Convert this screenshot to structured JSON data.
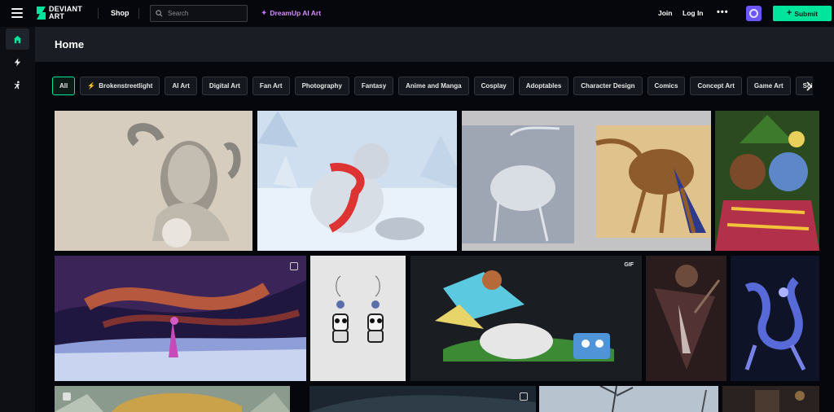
{
  "topbar": {
    "logo_text": "DEVIANT ART",
    "shop_label": "Shop",
    "search_placeholder": "Search",
    "dreamup_label": "DreamUp AI Art",
    "join_label": "Join",
    "login_label": "Log In",
    "more_label": "•••",
    "submit_label": "Submit"
  },
  "sidebar": {
    "items": [
      {
        "name": "home",
        "icon": "home-icon",
        "active": true
      },
      {
        "name": "activity",
        "icon": "lightning-icon",
        "active": false
      },
      {
        "name": "watch",
        "icon": "figure-icon",
        "active": false
      }
    ]
  },
  "header": {
    "title": "Home"
  },
  "chips": [
    {
      "label": "All",
      "active": true
    },
    {
      "label": "Brokenstreetlight",
      "active": false,
      "icon": "lightning-icon"
    },
    {
      "label": "AI Art",
      "active": false
    },
    {
      "label": "Digital Art",
      "active": false
    },
    {
      "label": "Fan Art",
      "active": false
    },
    {
      "label": "Photography",
      "active": false
    },
    {
      "label": "Fantasy",
      "active": false
    },
    {
      "label": "Anime and Manga",
      "active": false
    },
    {
      "label": "Cosplay",
      "active": false
    },
    {
      "label": "Adoptables",
      "active": false
    },
    {
      "label": "Character Design",
      "active": false
    },
    {
      "label": "Comics",
      "active": false
    },
    {
      "label": "Concept Art",
      "active": false
    },
    {
      "label": "Game Art",
      "active": false
    },
    {
      "label": "Science Fiction",
      "active": false
    }
  ],
  "gallery": {
    "row1": [
      "ram-horned-woman-sketch",
      "snow-leopard-red-scarf",
      "heron-and-anteater-creatures",
      "masked-raccoon-character"
    ],
    "row2": [
      "cosmic-landscape-figure",
      "panda-earrings",
      "pixel-art-battle-scene",
      "dark-fantasy-creature",
      "blue-dragon"
    ],
    "row3": [
      "golden-moon-mountains",
      "dark-landscape",
      "winter-trees",
      "dim-interior"
    ],
    "row2_badges": {
      "cosmic-landscape-figure": "multi-image",
      "pixel-art-battle-scene": "GIF"
    },
    "gif_label": "GIF"
  },
  "colors": {
    "accent": "#00e59b",
    "dreamup": "#d98bff",
    "core_badge": "#6b55ff",
    "background": "#06070d",
    "header_bg": "#1a1d23"
  }
}
